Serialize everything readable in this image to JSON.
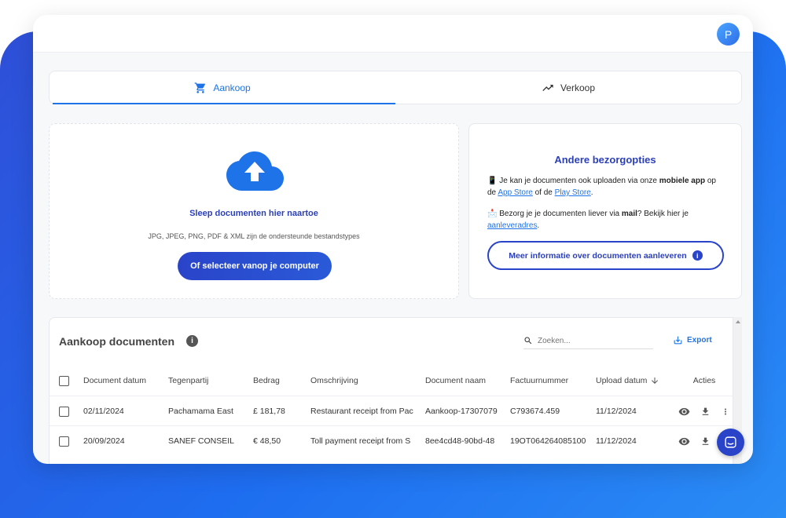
{
  "user": {
    "avatar_initial": "P"
  },
  "tabs": [
    {
      "label": "Aankoop",
      "icon": "cart-icon",
      "active": true
    },
    {
      "label": "Verkoop",
      "icon": "trending-up-icon",
      "active": false
    }
  ],
  "upload": {
    "title": "Sleep documenten hier naartoe",
    "subtitle": "JPG, JPEG, PNG, PDF & XML zijn de ondersteunde bestandstypes",
    "button_label": "Of selecteer vanop je computer"
  },
  "options": {
    "title": "Andere bezorgopties",
    "app_line": {
      "emoji": "📱",
      "prefix": "Je kan je documenten ook uploaden via onze ",
      "bold": "mobiele app",
      "mid": " op de ",
      "link1": "App Store",
      "mid2": " of de ",
      "link2": "Play Store",
      "suffix": "."
    },
    "mail_line": {
      "emoji": "📩",
      "prefix": "Bezorg je je documenten liever via ",
      "bold": "mail",
      "mid": "? Bekijk hier je ",
      "link": "aanleveradres",
      "suffix": "."
    },
    "info_button_label": "Meer informatie over documenten aanleveren"
  },
  "table": {
    "title": "Aankoop documenten",
    "search_placeholder": "Zoeken...",
    "export_label": "Export",
    "columns": [
      "Document datum",
      "Tegenpartij",
      "Bedrag",
      "Omschrijving",
      "Document naam",
      "Factuurnummer",
      "Upload datum",
      "Acties"
    ],
    "sort_column": "Upload datum",
    "rows": [
      {
        "date": "02/11/2024",
        "party": "Pachamama East",
        "amount": "£ 181,78",
        "description": "Restaurant receipt from Pac",
        "doc_name": "Aankoop-17307079",
        "invoice": "C793674.459",
        "upload": "11/12/2024"
      },
      {
        "date": "20/09/2024",
        "party": "SANEF CONSEIL",
        "amount": "€ 48,50",
        "description": "Toll payment receipt from S",
        "doc_name": "8ee4cd48-90bd-48",
        "invoice": "19OT064264085100",
        "upload": "11/12/2024"
      }
    ]
  },
  "colors": {
    "primary": "#2a44c9",
    "link": "#1f73e8",
    "background": "#1e6df0"
  }
}
